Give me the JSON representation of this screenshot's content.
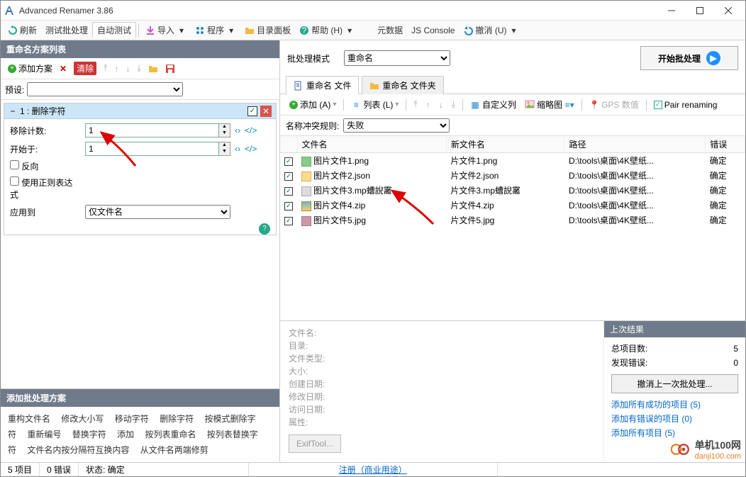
{
  "titlebar": {
    "title": "Advanced Renamer 3.86"
  },
  "toolbar": {
    "refresh": "刷新",
    "test": "测试批处理",
    "autotest": "自动测试",
    "import": "导入",
    "program": "程序",
    "catalog": "目录面板",
    "help": "帮助 (H)",
    "metadata": "元数据",
    "jsconsole": "JS Console",
    "undo": "撤消 (U)"
  },
  "leftpanel": {
    "header": "重命名方案列表",
    "addPlan": "添加方案",
    "clear": "清除",
    "preset": "预设:"
  },
  "method": {
    "title": "1 : 删除字符",
    "removeCountLabel": "移除计数:",
    "removeCount": "1",
    "startAtLabel": "开始于:",
    "startAt": "1",
    "backward": "反向",
    "regex": "使用正则表达式",
    "applyToLabel": "应用到",
    "applyTo": "仅文件名"
  },
  "addmethods": {
    "header": "添加批处理方案",
    "items": [
      "重构文件名",
      "修改大小写",
      "移动字符",
      "删除字符",
      "按模式删除字符",
      "重新编号",
      "替换字符",
      "添加",
      "按列表重命名",
      "按列表替换字符",
      "文件名内按分隔符互换内容",
      "从文件名两端修剪"
    ]
  },
  "mode": {
    "label": "批处理模式",
    "value": "重命名",
    "start": "开始批处理"
  },
  "tabs": {
    "files": "重命名 文件",
    "folders": "重命名 文件夹"
  },
  "filetb": {
    "add": "添加 (A)",
    "list": "列表 (L)",
    "custom": "自定义列",
    "thumb": "缩略图",
    "gps": "GPS 数值",
    "pair": "Pair renaming"
  },
  "conflict": {
    "label": "名称冲突规则:",
    "value": "失败"
  },
  "columns": {
    "filename": "文件名",
    "newname": "新文件名",
    "path": "路径",
    "error": "错误"
  },
  "files": [
    {
      "ic": "png",
      "name": "图片文件1.png",
      "new": "片文件1.png",
      "path": "D:\\tools\\桌面\\4K壁纸...",
      "err": "确定"
    },
    {
      "ic": "json",
      "name": "图片文件2.json",
      "new": "片文件2.json",
      "path": "D:\\tools\\桌面\\4K壁纸...",
      "err": "确定"
    },
    {
      "ic": "txt",
      "name": "图片文件3.mp螬誽霱",
      "new": "片文件3.mp螬誽霱",
      "path": "D:\\tools\\桌面\\4K壁纸...",
      "err": "确定"
    },
    {
      "ic": "zip",
      "name": "图片文件4.zip",
      "new": "片文件4.zip",
      "path": "D:\\tools\\桌面\\4K壁纸...",
      "err": "确定"
    },
    {
      "ic": "jpg",
      "name": "图片文件5.jpg",
      "new": "片文件5.jpg",
      "path": "D:\\tools\\桌面\\4K壁纸...",
      "err": "确定"
    }
  ],
  "info": {
    "l_filename": "文件名:",
    "l_dir": "目录:",
    "l_type": "文件类型:",
    "l_size": "大小:",
    "l_created": "创建日期:",
    "l_modified": "修改日期:",
    "l_accessed": "访问日期:",
    "l_attr": "属性:",
    "exif": "ExifTool..."
  },
  "results": {
    "header": "上次结果",
    "total_l": "总项目数:",
    "total_v": "5",
    "errors_l": "发现错误:",
    "errors_v": "0",
    "undo": "撤消上一次批处理...",
    "link1": "添加所有成功的项目 (5)",
    "link2": "添加有错误的项目 (0)",
    "link3": "添加所有项目 (5)"
  },
  "status": {
    "items": "5 项目",
    "errors": "0 错误",
    "state": "状态: 确定",
    "reg": "注册（商业用途）"
  },
  "watermark": {
    "t1": "单机100网",
    "t2": "danji100.com"
  }
}
